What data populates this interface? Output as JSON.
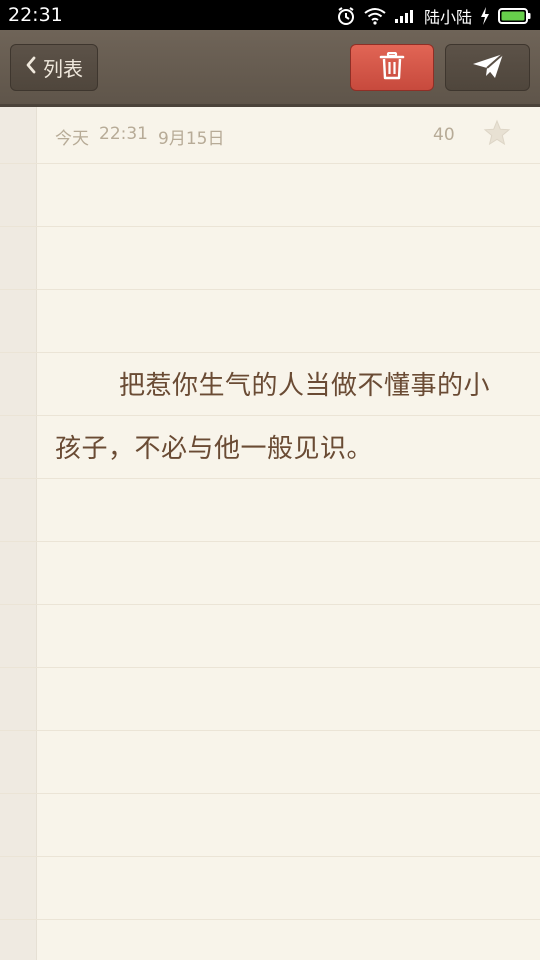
{
  "status_bar": {
    "time": "22:31",
    "carrier": "陆小陆",
    "icons": [
      "alarm-icon",
      "wifi-icon",
      "signal-icon",
      "charging-icon",
      "battery-icon"
    ]
  },
  "toolbar": {
    "back_label": "列表",
    "delete_icon": "trash-icon",
    "send_icon": "paper-plane-icon"
  },
  "note": {
    "date_label": "今天",
    "time": "22:31",
    "date": "9月15日",
    "char_count": "40",
    "starred": false,
    "content": "把惹你生气的人当做不懂事的小孩子，不必与他一般见识。"
  },
  "colors": {
    "toolbar": "#665b50",
    "delete_button": "#d55648",
    "paper": "#f8f4ea",
    "text": "#6a4b34",
    "meta": "#b7ab97"
  }
}
